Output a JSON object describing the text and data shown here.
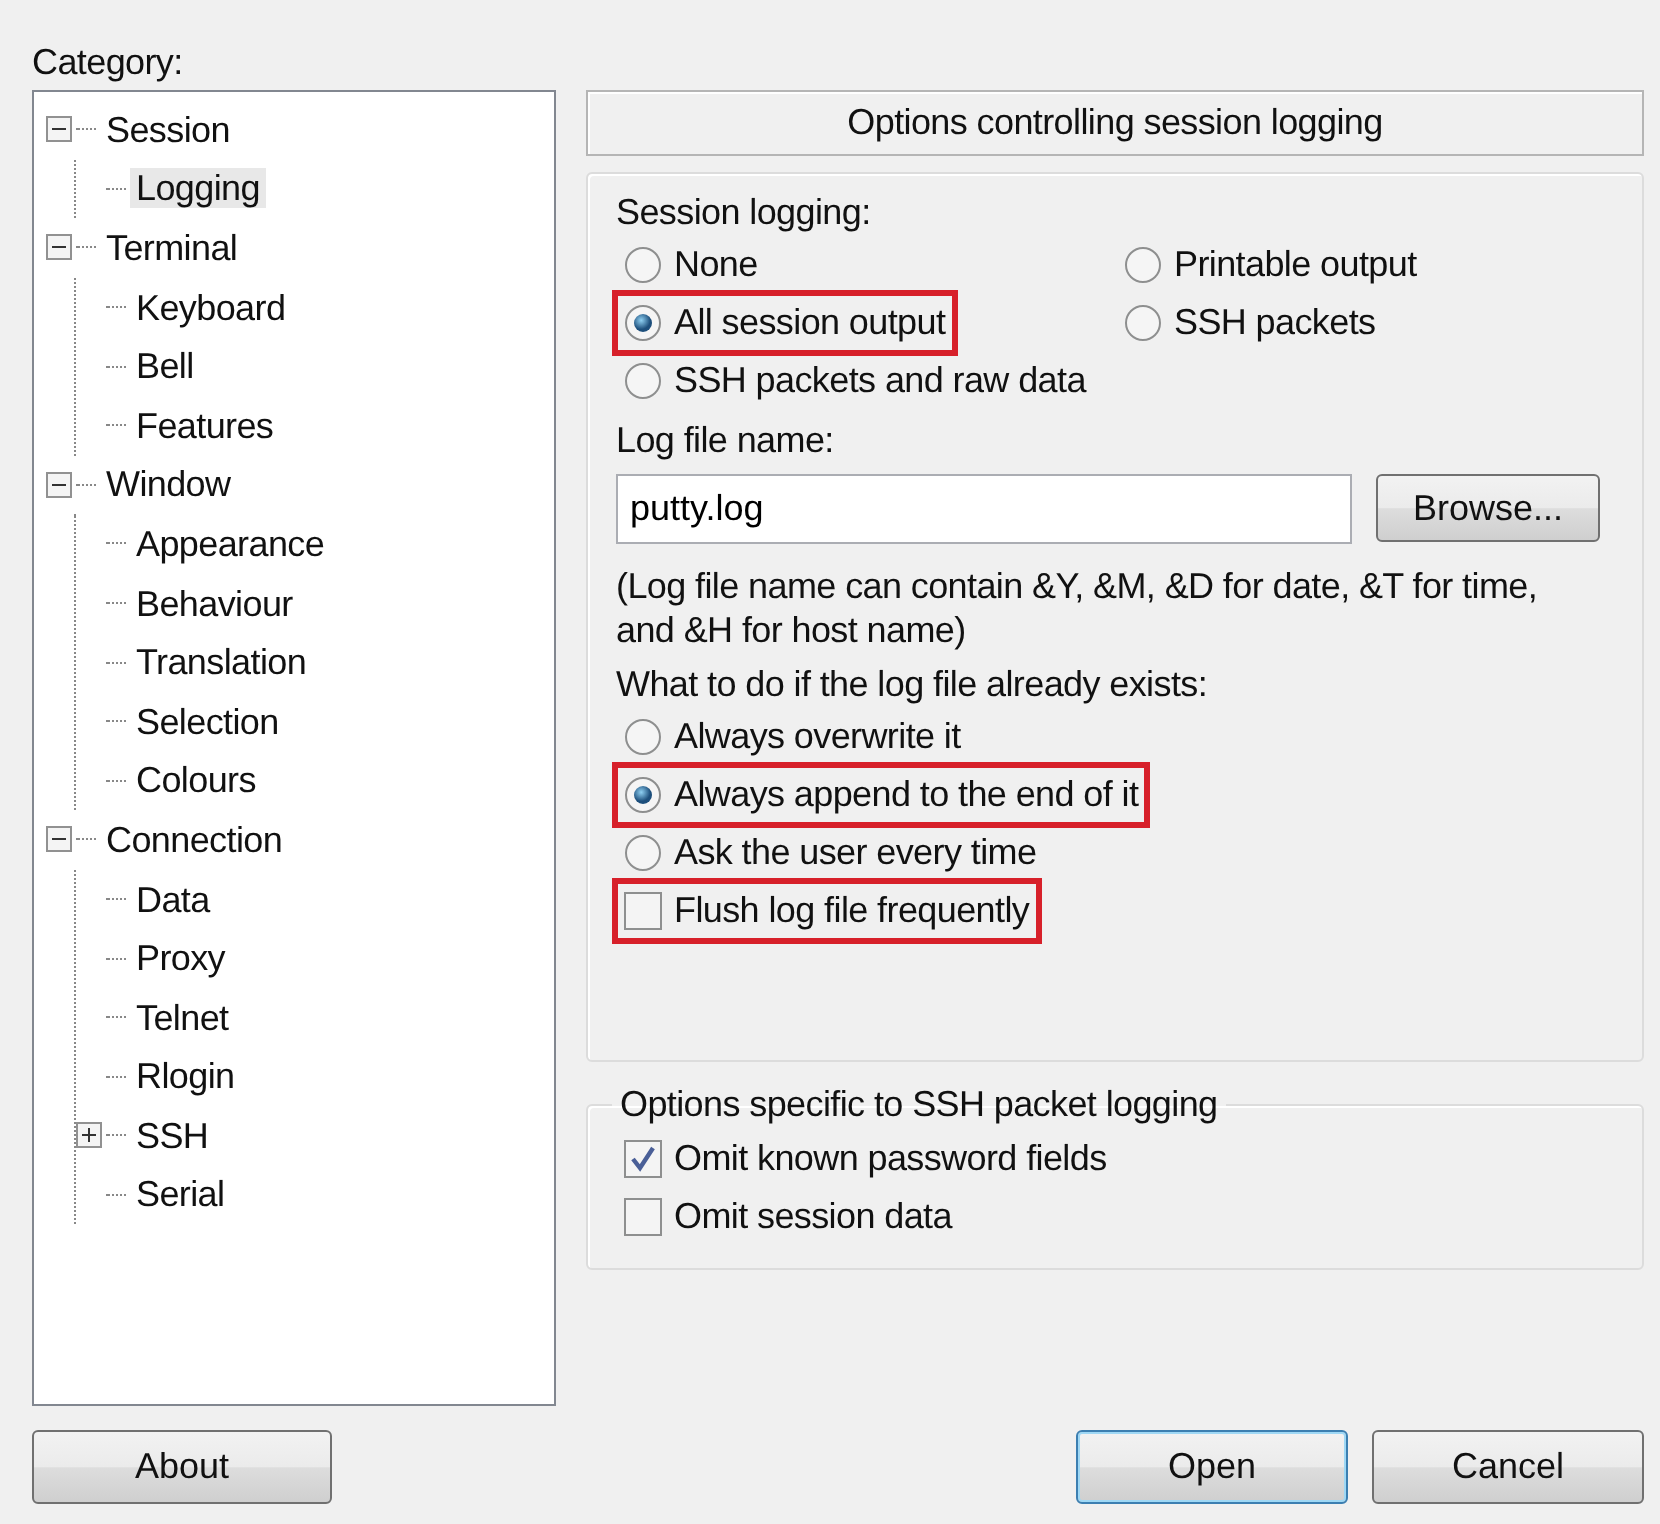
{
  "category_label": "Category:",
  "tree": [
    {
      "label": "Session",
      "expanded": true,
      "selected": false,
      "children": [
        {
          "label": "Logging",
          "selected": true
        }
      ]
    },
    {
      "label": "Terminal",
      "expanded": true,
      "selected": false,
      "children": [
        {
          "label": "Keyboard",
          "selected": false
        },
        {
          "label": "Bell",
          "selected": false
        },
        {
          "label": "Features",
          "selected": false
        }
      ]
    },
    {
      "label": "Window",
      "expanded": true,
      "selected": false,
      "children": [
        {
          "label": "Appearance",
          "selected": false
        },
        {
          "label": "Behaviour",
          "selected": false
        },
        {
          "label": "Translation",
          "selected": false
        },
        {
          "label": "Selection",
          "selected": false
        },
        {
          "label": "Colours",
          "selected": false
        }
      ]
    },
    {
      "label": "Connection",
      "expanded": true,
      "selected": false,
      "children": [
        {
          "label": "Data",
          "selected": false
        },
        {
          "label": "Proxy",
          "selected": false
        },
        {
          "label": "Telnet",
          "selected": false
        },
        {
          "label": "Rlogin",
          "selected": false
        },
        {
          "label": "SSH",
          "expanded": false,
          "selected": false
        },
        {
          "label": "Serial",
          "selected": false
        }
      ]
    }
  ],
  "panel_title": "Options controlling session logging",
  "session_logging": {
    "label": "Session logging:",
    "options": [
      {
        "label": "None",
        "selected": false,
        "highlighted": false
      },
      {
        "label": "Printable output",
        "selected": false,
        "highlighted": false
      },
      {
        "label": "All session output",
        "selected": true,
        "highlighted": true
      },
      {
        "label": "SSH packets",
        "selected": false,
        "highlighted": false
      },
      {
        "label": "SSH packets and raw data",
        "selected": false,
        "highlighted": false
      }
    ]
  },
  "log_file": {
    "label": "Log file name:",
    "value": "putty.log",
    "browse": "Browse...",
    "hint": "(Log file name can contain &Y, &M, &D for date, &T for time, and &H for host name)"
  },
  "exists": {
    "label": "What to do if the log file already exists:",
    "options": [
      {
        "label": "Always overwrite it",
        "selected": false,
        "highlighted": false
      },
      {
        "label": "Always append to the end of it",
        "selected": true,
        "highlighted": true
      },
      {
        "label": "Ask the user every time",
        "selected": false,
        "highlighted": false
      }
    ]
  },
  "flush": {
    "label": "Flush log file frequently",
    "checked": false,
    "highlighted": true
  },
  "ssh_group": {
    "title": "Options specific to SSH packet logging",
    "options": [
      {
        "label": "Omit known password fields",
        "checked": true
      },
      {
        "label": "Omit session data",
        "checked": false
      }
    ]
  },
  "buttons": [
    {
      "label": "About",
      "default": false
    },
    {
      "label": "Open",
      "default": true
    },
    {
      "label": "Cancel",
      "default": false
    }
  ]
}
